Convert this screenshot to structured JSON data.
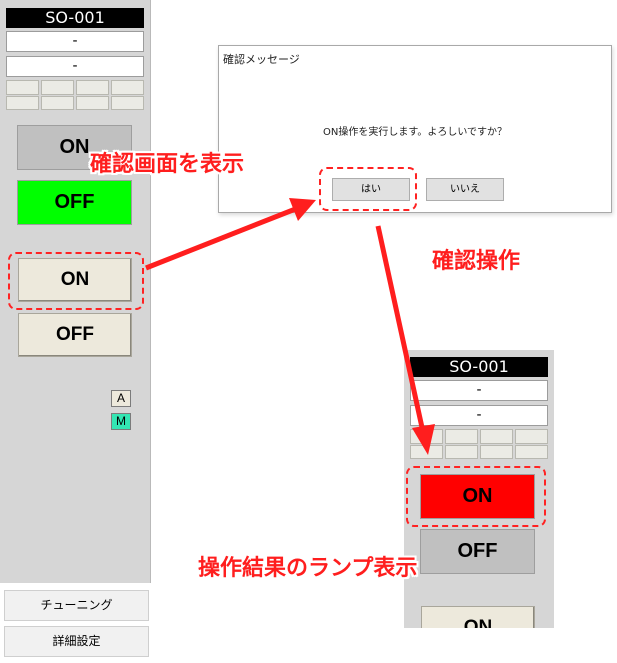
{
  "left_panel": {
    "tag": "SO-001",
    "field1": "-",
    "field2": "-",
    "lamp_on_label": "ON",
    "lamp_off_label": "OFF",
    "btn_on_label": "ON",
    "btn_off_label": "OFF",
    "mode_a": "A",
    "mode_m": "M",
    "tuning_label": "チューニング",
    "details_label": "詳細設定"
  },
  "dialog": {
    "title": "確認メッセージ",
    "message": "ON操作を実行します。よろしいですか？",
    "yes_label": "はい",
    "no_label": "いいえ"
  },
  "result_panel": {
    "tag": "SO-001",
    "field1": "-",
    "field2": "-",
    "lamp_on_label": "ON",
    "lamp_off_label": "OFF",
    "btn_on_label": "ON"
  },
  "annotations": {
    "show_confirm": "確認画面を表示",
    "confirm_op": "確認操作",
    "result_lamp": "操作結果のランプ表示"
  },
  "colors": {
    "lamp_green": "#00ff00",
    "lamp_red": "#ff0000",
    "lamp_gray": "#c0c0c0",
    "mode_active": "#33e6b3",
    "annotation_red": "#ff1e1e"
  }
}
